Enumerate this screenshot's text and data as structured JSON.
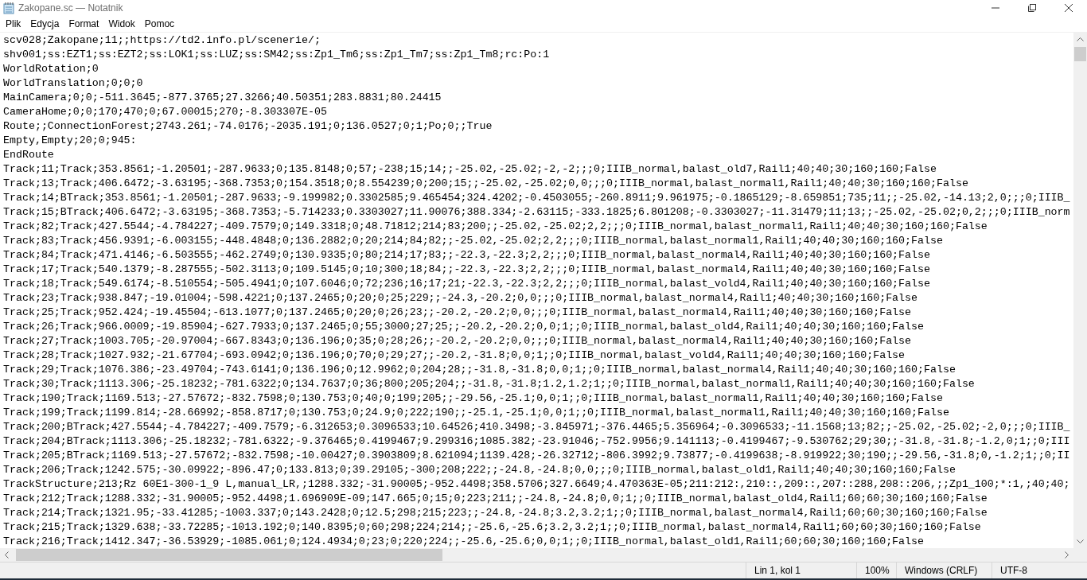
{
  "window": {
    "title": "Zakopane.sc — Notatnik"
  },
  "menu": [
    "Plik",
    "Edycja",
    "Format",
    "Widok",
    "Pomoc"
  ],
  "lines": [
    "scv028;Zakopane;11;;https://td2.info.pl/scenerie/;",
    "shv001;ss:EZT1;ss:EZT2;ss:LOK1;ss:LUZ;ss:SM42;ss:Zp1_Tm6;ss:Zp1_Tm7;ss:Zp1_Tm8;rc:Po:1",
    "WorldRotation;0",
    "WorldTranslation;0;0;0",
    "MainCamera;0;0;-511.3645;-877.3765;27.3266;40.50351;283.8831;80.24415",
    "CameraHome;0;0;170;470;0;67.00015;270;-8.303307E-05",
    "Route;;ConnectionForest;2743.261;-74.0176;-2035.191;0;136.0527;0;1;Po;0;;True",
    "Empty,Empty;20;0;945:",
    "EndRoute",
    "Track;11;Track;353.8561;-1.20501;-287.9633;0;135.8148;0;57;-238;15;14;;-25.02,-25.02;-2,-2;;;0;IIIB_normal,balast_old7,Rail1;40;40;30;160;160;False",
    "Track;13;Track;406.6472;-3.63195;-368.7353;0;154.3518;0;8.554239;0;200;15;;-25.02,-25.02;0,0;;;0;IIIB_normal,balast_normal1,Rail1;40;40;30;160;160;False",
    "Track;14;BTrack;353.8561;-1.20501;-287.9633;-9.199982;0.3302585;9.465454;324.4202;-0.4503055;-260.8911;9.961975;-0.1865129;-8.659851;735;11;;-25.02,-14.13;2,0;;;0;IIIB_",
    "Track;15;BTrack;406.6472;-3.63195;-368.7353;-5.714233;0.3303027;11.90076;388.334;-2.63115;-333.1825;6.801208;-0.3303027;-11.31479;11;13;;-25.02,-25.02;0,2;;;0;IIIB_norm",
    "Track;82;Track;427.5544;-4.784227;-409.7579;0;149.3318;0;48.71812;214;83;200;;-25.02,-25.02;2,2;;;0;IIIB_normal,balast_normal1,Rail1;40;40;30;160;160;False",
    "Track;83;Track;456.9391;-6.003155;-448.4848;0;136.2882;0;20;214;84;82;;-25.02,-25.02;2,2;;;0;IIIB_normal,balast_normal1,Rail1;40;40;30;160;160;False",
    "Track;84;Track;471.4146;-6.503555;-462.2749;0;130.9335;0;80;214;17;83;;-22.3,-22.3;2,2;;;0;IIIB_normal,balast_normal4,Rail1;40;40;30;160;160;False",
    "Track;17;Track;540.1379;-8.287555;-502.3113;0;109.5145;0;10;300;18;84;;-22.3,-22.3;2,2;;;0;IIIB_normal,balast_normal4,Rail1;40;40;30;160;160;False",
    "Track;18;Track;549.6174;-8.510554;-505.4941;0;107.6046;0;72;236;16;17;21;-22.3,-22.3;2,2;;;0;IIIB_normal,balast_vold4,Rail1;40;40;30;160;160;False",
    "Track;23;Track;938.847;-19.01004;-598.4221;0;137.2465;0;20;0;25;229;;-24.3,-20.2;0,0;;;0;IIIB_normal,balast_normal4,Rail1;40;40;30;160;160;False",
    "Track;25;Track;952.424;-19.45504;-613.1077;0;137.2465;0;20;0;26;23;;-20.2,-20.2;0,0;;;0;IIIB_normal,balast_normal4,Rail1;40;40;30;160;160;False",
    "Track;26;Track;966.0009;-19.85904;-627.7933;0;137.2465;0;55;3000;27;25;;-20.2,-20.2;0,0;1;;0;IIIB_normal,balast_old4,Rail1;40;40;30;160;160;False",
    "Track;27;Track;1003.705;-20.97004;-667.8343;0;136.196;0;35;0;28;26;;-20.2,-20.2;0,0;;;0;IIIB_normal,balast_normal4,Rail1;40;40;30;160;160;False",
    "Track;28;Track;1027.932;-21.67704;-693.0942;0;136.196;0;70;0;29;27;;-20.2,-31.8;0,0;1;;0;IIIB_normal,balast_vold4,Rail1;40;40;30;160;160;False",
    "Track;29;Track;1076.386;-23.49704;-743.6141;0;136.196;0;12.9962;0;204;28;;-31.8,-31.8;0,0;1;;0;IIIB_normal,balast_normal4,Rail1;40;40;30;160;160;False",
    "Track;30;Track;1113.306;-25.18232;-781.6322;0;134.7637;0;36;800;205;204;;-31.8,-31.8;1.2,1.2;1;;0;IIIB_normal,balast_normal1,Rail1;40;40;30;160;160;False",
    "Track;190;Track;1169.513;-27.57672;-832.7598;0;130.753;0;40;0;199;205;;-29.56,-25.1;0,0;1;;0;IIIB_normal,balast_normal1,Rail1;40;40;30;160;160;False",
    "Track;199;Track;1199.814;-28.66992;-858.8717;0;130.753;0;24.9;0;222;190;;-25.1,-25.1;0,0;1;;0;IIIB_normal,balast_normal1,Rail1;40;40;30;160;160;False",
    "Track;200;BTrack;427.5544;-4.784227;-409.7579;-6.312653;0.3096533;10.64526;410.3498;-3.845971;-376.4465;5.356964;-0.3096533;-11.1568;13;82;;-25.02,-25.02;-2,0;;;0;IIIB_",
    "Track;204;BTrack;1113.306;-25.18232;-781.6322;-9.376465;0.4199467;9.299316;1085.382;-23.91046;-752.9956;9.141113;-0.4199467;-9.530762;29;30;;-31.8,-31.8;-1.2,0;1;;0;III",
    "Track;205;BTrack;1169.513;-27.57672;-832.7598;-10.00427;0.3903809;8.621094;1139.428;-26.32712;-806.3992;9.73877;-0.4199638;-8.919922;30;190;;-29.56,-31.8;0,-1.2;1;;0;II",
    "Track;206;Track;1242.575;-30.09922;-896.47;0;133.813;0;39.29105;-300;208;222;;-24.8,-24.8;0,0;;;0;IIIB_normal,balast_old1,Rail1;40;40;30;160;160;False",
    "TrackStructure;213;Rz 60E1-300-1_9 L,manual_LR,;1288.332;-31.90005;-952.4498;358.5706;327.6649;4.470363E-05;211:212:,210::,209::,207::288,208::206,;;Zp1_100;*:1,;40;40;",
    "Track;212;Track;1288.332;-31.90005;-952.4498;1.696909E-09;147.665;0;15;0;223;211;;-24.8,-24.8;0,0;1;;0;IIIB_normal,balast_old4,Rail1;60;60;30;160;160;False",
    "Track;214;Track;1321.95;-33.41285;-1003.337;0;143.2428;0;12.5;298;215;223;;-24.8,-24.8;3.2,3.2;1;;0;IIIB_normal,balast_normal4,Rail1;60;60;30;160;160;False",
    "Track;215;Track;1329.638;-33.72285;-1013.192;0;140.8395;0;60;298;224;214;;-25.6,-25.6;3.2,3.2;1;;0;IIIB_normal,balast_normal4,Rail1;60;60;30;160;160;False",
    "Track;216;Track;1412.347;-36.53929;-1085.061;0;124.4934;0;23;0;220;224;;-25.6,-25.6;0,0;1;;0;IIIB_normal,balast_old1,Rail1;60;60;30;160;160;False"
  ],
  "status_bar": [
    "Lin 1, kol 1",
    "100%",
    "Windows (CRLF)",
    "UTF-8"
  ]
}
